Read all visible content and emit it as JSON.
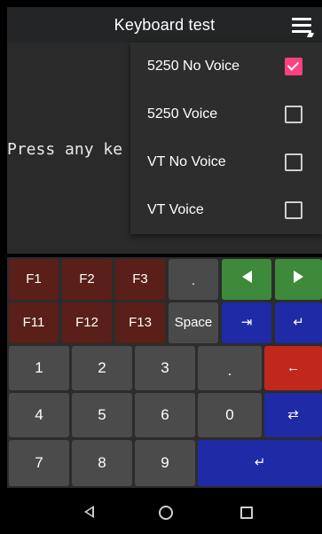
{
  "appbar": {
    "title": "Keyboard test",
    "menu_icon": "menu-icon"
  },
  "terminal": {
    "text": "Press any ke"
  },
  "menu": {
    "items": [
      {
        "label": "5250 No Voice",
        "checked": true
      },
      {
        "label": "5250 Voice",
        "checked": false
      },
      {
        "label": "VT No Voice",
        "checked": false
      },
      {
        "label": "VT Voice",
        "checked": false
      }
    ]
  },
  "keyboard": {
    "f1": "F1",
    "f2": "F2",
    "f3": "F3",
    "dot_top": ".",
    "f11": "F11",
    "f12": "F12",
    "f13": "F13",
    "space": "Space",
    "tab_glyph": "⇥",
    "return_glyph": "↵",
    "n1": "1",
    "n2": "2",
    "n3": "3",
    "dot": ".",
    "backspace_glyph": "←",
    "n4": "4",
    "n5": "5",
    "n6": "6",
    "n0": "0",
    "fieldexit_glyph": "⇄",
    "n7": "7",
    "n8": "8",
    "n9": "9",
    "enter_glyph": "↵"
  },
  "colors": {
    "accent": "#ff4081",
    "green": "#3c8a3a",
    "blue": "#1f2aa6",
    "red": "#c0281e",
    "fkey": "#5a1f18"
  }
}
